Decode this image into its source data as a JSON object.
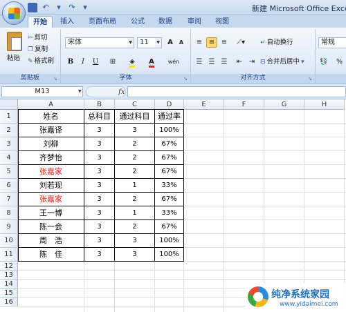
{
  "window": {
    "title": "新建 Microsoft Office Excel 工",
    "accent": "#15428b"
  },
  "quick_access": {
    "save_icon": "save-icon",
    "undo_icon": "undo-icon",
    "redo_icon": "redo-icon",
    "customize_icon": "chevron-down-icon"
  },
  "tabs": [
    "开始",
    "插入",
    "页面布局",
    "公式",
    "数据",
    "审阅",
    "视图"
  ],
  "ribbon": {
    "clipboard": {
      "paste": "粘贴",
      "cut": "剪切",
      "copy": "复制",
      "format_painter": "格式刷",
      "group_label": "剪贴板"
    },
    "font": {
      "font_name": "宋体",
      "font_size": "11",
      "grow": "A",
      "shrink": "A",
      "bold": "B",
      "italic": "I",
      "underline": "U",
      "font_color_letter": "A",
      "phonetic": "wén",
      "group_label": "字体"
    },
    "alignment": {
      "wrap_text": "自动换行",
      "merge_center": "合并后居中",
      "group_label": "对齐方式"
    },
    "number": {
      "format": "常规",
      "percent": "%"
    }
  },
  "formula_bar": {
    "name_box": "M13",
    "fx_label": "fx",
    "value": ""
  },
  "columns": [
    "A",
    "B",
    "C",
    "D",
    "E",
    "F",
    "G",
    "H"
  ],
  "rows": [
    "1",
    "2",
    "3",
    "4",
    "5",
    "6",
    "7",
    "8",
    "9",
    "10",
    "11",
    "12",
    "13",
    "14",
    "15",
    "16"
  ],
  "table": {
    "headers": [
      "姓名",
      "总科目",
      "通过科目",
      "通过率"
    ],
    "rows": [
      {
        "name": "张嘉译",
        "total": "3",
        "passed": "3",
        "rate": "100%",
        "highlight": false
      },
      {
        "name": "刘柳",
        "total": "3",
        "passed": "2",
        "rate": "67%",
        "highlight": false
      },
      {
        "name": "齐梦怡",
        "total": "3",
        "passed": "2",
        "rate": "67%",
        "highlight": false
      },
      {
        "name": "张嘉家",
        "total": "3",
        "passed": "2",
        "rate": "67%",
        "highlight": true
      },
      {
        "name": "刘若现",
        "total": "3",
        "passed": "1",
        "rate": "33%",
        "highlight": false
      },
      {
        "name": "张嘉家",
        "total": "3",
        "passed": "2",
        "rate": "67%",
        "highlight": true
      },
      {
        "name": "王一博",
        "total": "3",
        "passed": "1",
        "rate": "33%",
        "highlight": false
      },
      {
        "name": "陈一会",
        "total": "3",
        "passed": "2",
        "rate": "67%",
        "highlight": false
      },
      {
        "name": "周　浩",
        "total": "3",
        "passed": "3",
        "rate": "100%",
        "highlight": false
      },
      {
        "name": "陈　佳",
        "total": "3",
        "passed": "3",
        "rate": "100%",
        "highlight": false
      }
    ],
    "highlight_color": "#e0201b"
  },
  "watermark": {
    "title": "纯净系统家园",
    "url": "www.yidaimei.com"
  }
}
